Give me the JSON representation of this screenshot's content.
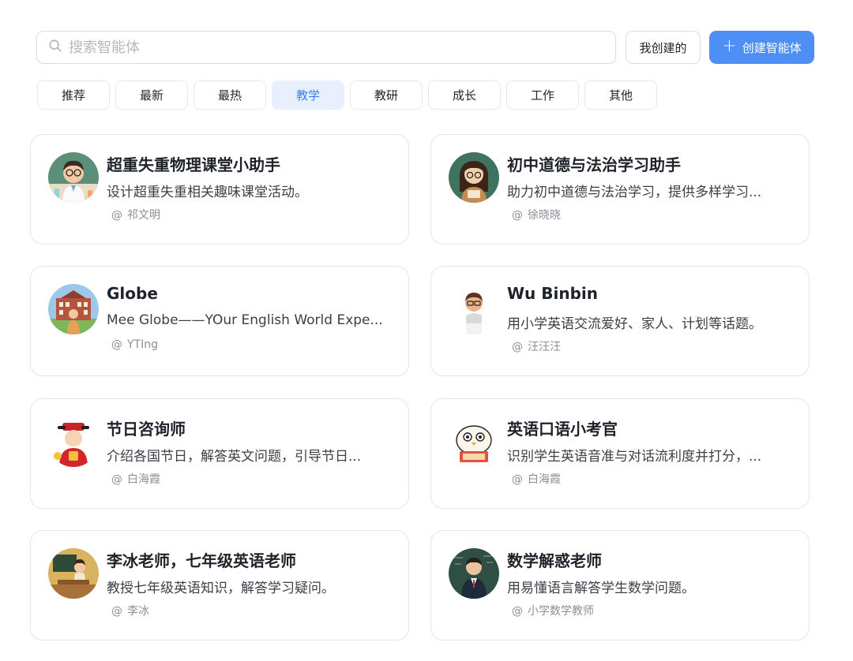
{
  "search": {
    "placeholder": "搜索智能体"
  },
  "actions": {
    "mine_label": "我创建的",
    "create_label": "创建智能体"
  },
  "tabs": [
    {
      "label": "推荐",
      "active": false
    },
    {
      "label": "最新",
      "active": false
    },
    {
      "label": "最热",
      "active": false
    },
    {
      "label": "教学",
      "active": true
    },
    {
      "label": "教研",
      "active": false
    },
    {
      "label": "成长",
      "active": false
    },
    {
      "label": "工作",
      "active": false
    },
    {
      "label": "其他",
      "active": false
    }
  ],
  "colors": {
    "accent": "#4d8ff5",
    "active_tab_bg": "#e8f0fe",
    "active_tab_text": "#3a7ff2"
  },
  "author_prefix": "@",
  "agents": [
    {
      "title": "超重失重物理课堂小助手",
      "desc": "设计超重失重相关趣味课堂活动。",
      "author": "祁文明",
      "avatar": "teacher-lab-avatar"
    },
    {
      "title": "初中道德与法治学习助手",
      "desc": "助力初中道德与法治学习，提供多样学习...",
      "author": "徐晓晓",
      "avatar": "girl-student-avatar"
    },
    {
      "title": "Globe",
      "desc": "Mee Globe——YOur English World Expe...",
      "author": "YTIng",
      "avatar": "school-building-avatar"
    },
    {
      "title": "Wu Binbin",
      "desc": "用小学英语交流爱好、家人、计划等话题。",
      "author": "汪汪汪",
      "avatar": "cartoon-boy-avatar"
    },
    {
      "title": "节日咨询师",
      "desc": "介绍各国节日，解答英文问题，引导节日...",
      "author": "白海霞",
      "avatar": "fortune-god-avatar"
    },
    {
      "title": "英语口语小考官",
      "desc": "识别学生英语音准与对话流利度并打分，...",
      "author": "白海霞",
      "avatar": "reading-bird-avatar"
    },
    {
      "title": "李冰老师，七年级英语老师",
      "desc": "教授七年级英语知识，解答学习疑问。",
      "author": "李冰",
      "avatar": "classroom-teacher-avatar"
    },
    {
      "title": "数学解惑老师",
      "desc": "用易懂语言解答学生数学问题。",
      "author": "小学数学教师",
      "avatar": "math-teacher-avatar"
    }
  ]
}
